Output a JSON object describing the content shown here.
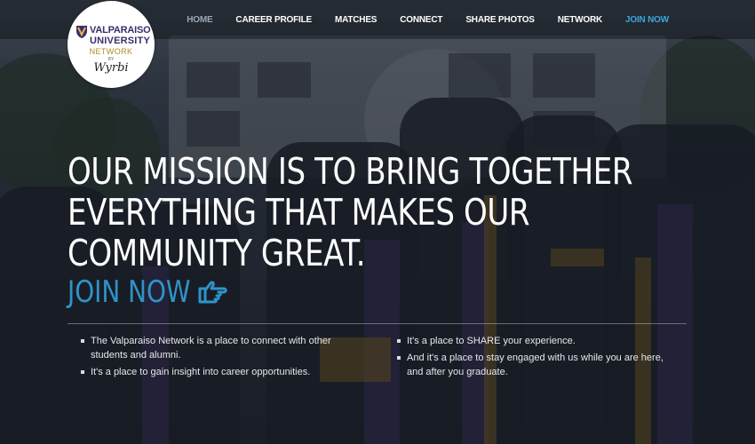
{
  "logo": {
    "line1": "VALPARAISO",
    "line2": "UNIVERSITY",
    "line3": "NETWORK",
    "line4": "BY",
    "line5": "Wyrbi"
  },
  "nav": {
    "items": [
      {
        "label": "HOME"
      },
      {
        "label": "CAREER PROFILE"
      },
      {
        "label": "MATCHES"
      },
      {
        "label": "CONNECT"
      },
      {
        "label": "SHARE PHOTOS"
      },
      {
        "label": "NETWORK"
      },
      {
        "label": "JOIN NOW"
      }
    ]
  },
  "hero": {
    "line1": "OUR MISSION IS TO BRING TOGETHER",
    "line2": "EVERYTHING THAT MAKES OUR",
    "line3": "COMMUNITY GREAT.",
    "cta": "JOIN NOW"
  },
  "bullets": {
    "left": [
      "The Valparaiso Network is a place to connect with other students and alumni.",
      "It's a place to gain insight into career opportunities."
    ],
    "right": [
      "It's a place to SHARE your experience.",
      "And it's a place to stay engaged with us while you are here, and after you graduate."
    ]
  },
  "colors": {
    "accent": "#2f93c9",
    "nav_join": "#3aa7de",
    "nav_active": "#9aa7b8",
    "brand_purple": "#3d2d6b",
    "brand_gold": "#b08a2a"
  },
  "icons": {
    "cta_icon": "pointing-hand-icon",
    "logo_icon": "shield-icon"
  }
}
